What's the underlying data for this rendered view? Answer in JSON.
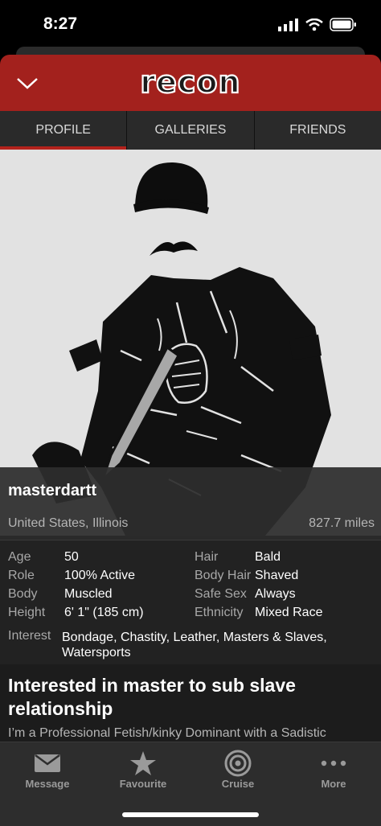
{
  "status_bar": {
    "time": "8:27"
  },
  "header": {
    "logo_text": "recon"
  },
  "tabs": [
    {
      "label": "PROFILE",
      "active": true
    },
    {
      "label": "GALLERIES",
      "active": false
    },
    {
      "label": "FRIENDS",
      "active": false
    }
  ],
  "profile": {
    "username": "masterdartt",
    "location": "United States, Illinois",
    "distance": "827.7 miles"
  },
  "stats": {
    "age": {
      "label": "Age",
      "value": "50"
    },
    "role": {
      "label": "Role",
      "value": "100% Active"
    },
    "body": {
      "label": "Body",
      "value": "Muscled"
    },
    "height": {
      "label": "Height",
      "value": "6' 1\" (185 cm)"
    },
    "hair": {
      "label": "Hair",
      "value": "Bald"
    },
    "body_hair": {
      "label": "Body Hair",
      "value": "Shaved"
    },
    "safe_sex": {
      "label": "Safe Sex",
      "value": "Always"
    },
    "ethnicity": {
      "label": "Ethnicity",
      "value": "Mixed Race"
    },
    "interest": {
      "label": "Interest",
      "value_line1": "Bondage, Chastity, Leather, Masters & Slaves,",
      "value_line2": "Watersports"
    }
  },
  "about": {
    "title": "Interested in master to sub slave relationship",
    "text": "I’m a Professional Fetish/kinky Dominant with a Sadistic"
  },
  "bottom_nav": [
    {
      "label": "Message",
      "icon": "envelope-icon"
    },
    {
      "label": "Favourite",
      "icon": "star-icon"
    },
    {
      "label": "Cruise",
      "icon": "target-icon"
    },
    {
      "label": "More",
      "icon": "more-dots-icon"
    }
  ],
  "colors": {
    "brand_red": "#a3211d",
    "tab_indicator": "#b3221c"
  }
}
